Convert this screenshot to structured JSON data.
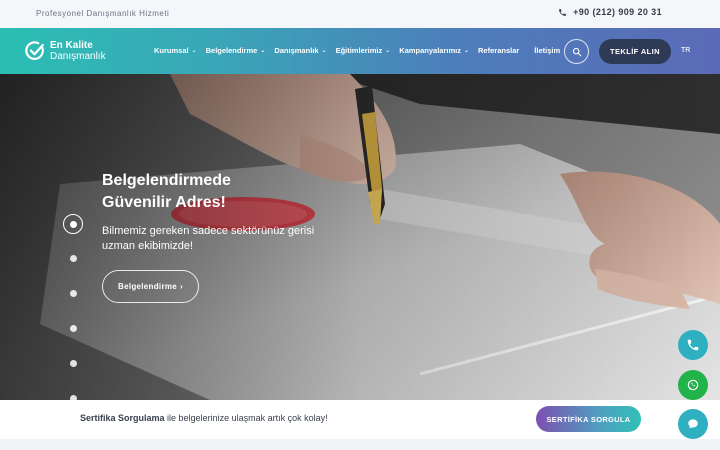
{
  "topbar": {
    "tagline": "Profesyonel Danışmanlık Hizmeti",
    "phone": "+90 (212) 909 20 31"
  },
  "brand": {
    "line1": "En Kalite",
    "line2": "Danışmanlık"
  },
  "nav": {
    "items": [
      {
        "label": "Kurumsal",
        "dropdown": true
      },
      {
        "label": "Belgelendirme",
        "dropdown": true
      },
      {
        "label": "Danışmanlık",
        "dropdown": true
      },
      {
        "label": "Eğitimlerimiz",
        "dropdown": true
      },
      {
        "label": "Kampanyalarımız",
        "dropdown": true
      },
      {
        "label": "Referanslar",
        "dropdown": false
      },
      {
        "label": "İletişim",
        "dropdown": false
      }
    ],
    "offer_label": "TEKLİF ALIN",
    "lang": "TR"
  },
  "hero": {
    "title": "Belgelendirmede Güvenilir Adres!",
    "subtitle": "Bilmemiz gereken sadece sektörünüz gerisi uzman ekibimizde!",
    "button_label": "Belgelendirme",
    "slide_count": 6,
    "active_slide": 1
  },
  "cert_bar": {
    "bold_text": "Sertifika Sorgulama",
    "text": " ile belgelerinize ulaşmak artık çok kolay!",
    "button_label": "SERTİFİKA SORGULA"
  },
  "colors": {
    "nav_gradient_start": "#2bbfb3",
    "nav_gradient_end": "#5b6ab8",
    "offer_button": "#2f3a56",
    "whatsapp": "#22b34a",
    "call": "#2fb0c0"
  },
  "icons": {
    "phone": "phone-icon",
    "search": "search-icon",
    "chevron": "chevron-down-icon",
    "arrow": "chevron-right-icon",
    "whatsapp": "whatsapp-icon",
    "chat": "chat-icon"
  }
}
